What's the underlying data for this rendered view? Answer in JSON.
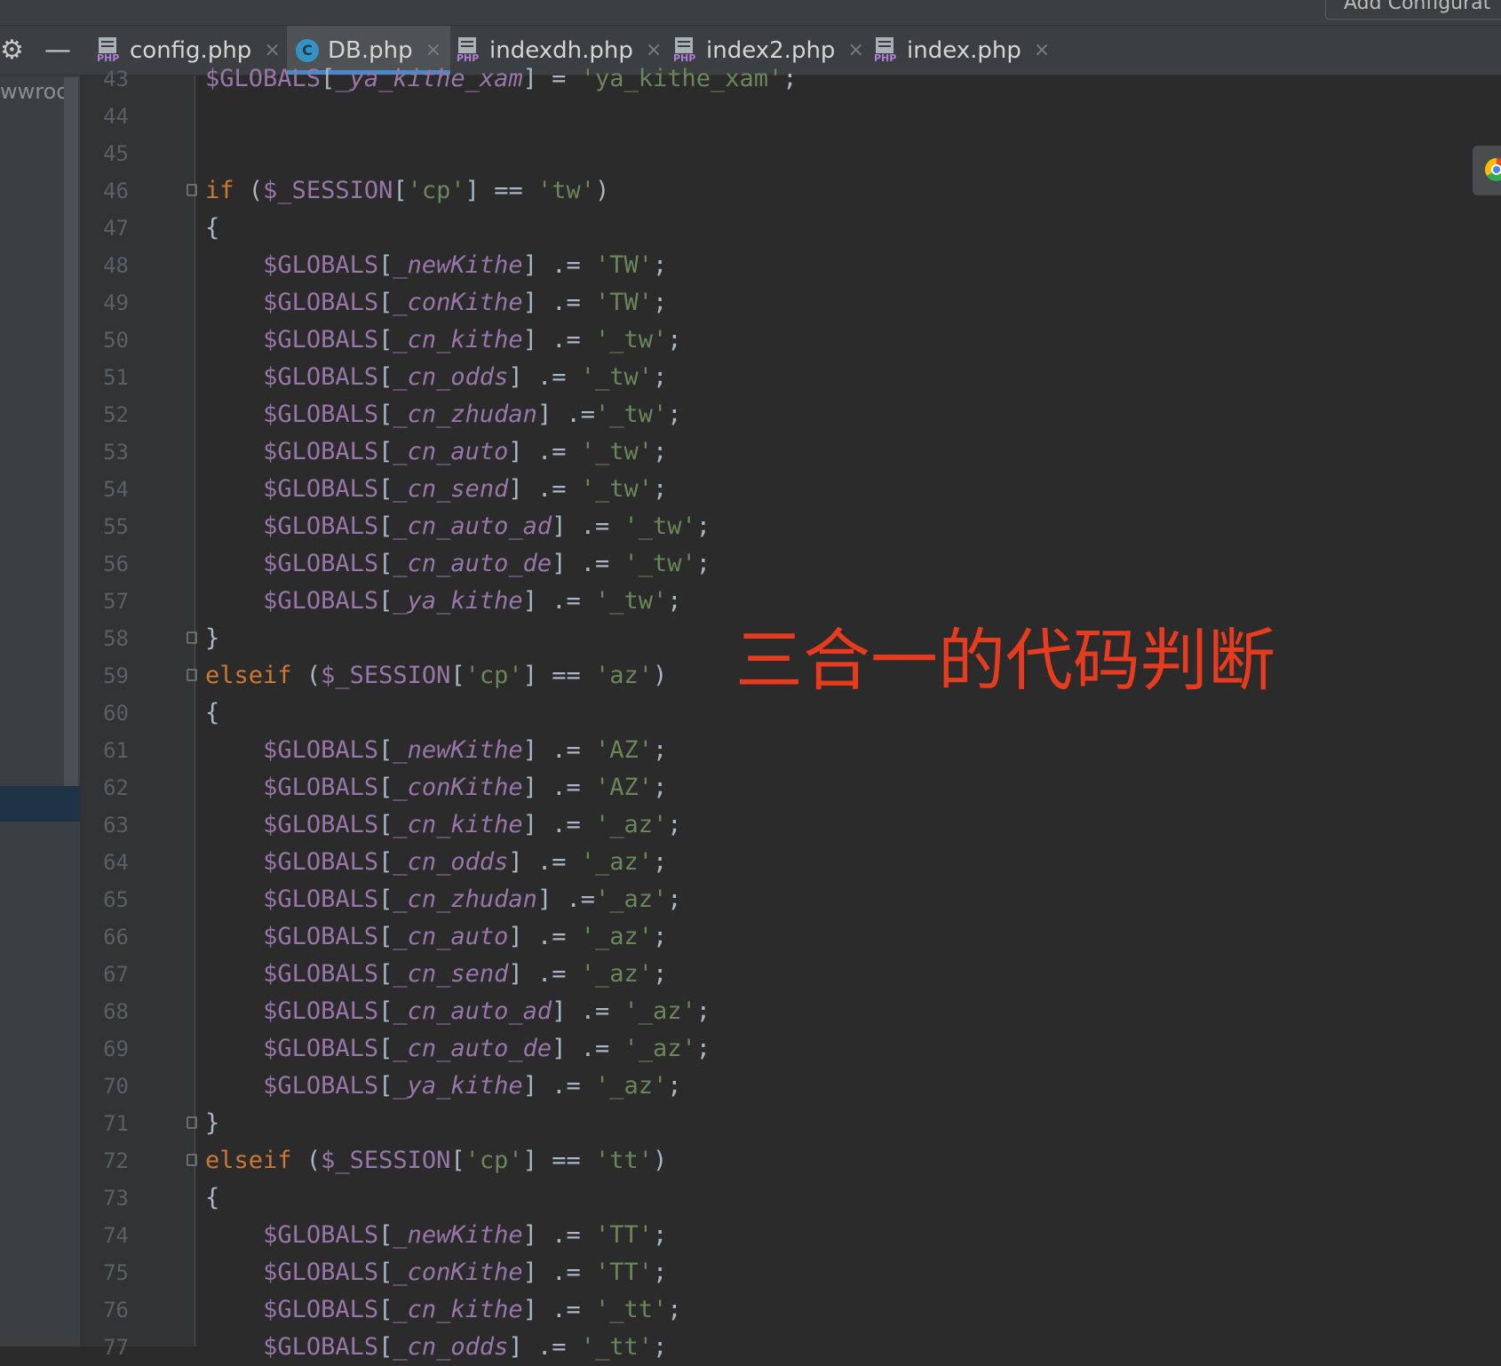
{
  "toolbar": {
    "add_configuration_label": "Add Configurat"
  },
  "tabs": [
    {
      "label": "config.php",
      "icon": "php-file-icon",
      "active": false
    },
    {
      "label": "DB.php",
      "icon": "php-class-icon",
      "active": true
    },
    {
      "label": "indexdh.php",
      "icon": "php-file-icon",
      "active": false
    },
    {
      "label": "index2.php",
      "icon": "php-file-icon",
      "active": false
    },
    {
      "label": "index.php",
      "icon": "php-file-icon",
      "active": false
    }
  ],
  "project_panel": {
    "label": "wwroot"
  },
  "annotation": "三合一的代码判断",
  "code_lines": [
    {
      "n": "43",
      "text": "$GLOBALS[_ya_kithe_xam] = 'ya_kithe_xam';"
    },
    {
      "n": "44",
      "text": ""
    },
    {
      "n": "45",
      "text": ""
    },
    {
      "n": "46",
      "text": "if ($_SESSION['cp'] == 'tw')"
    },
    {
      "n": "47",
      "text": "{"
    },
    {
      "n": "48",
      "text": "    $GLOBALS[_newKithe] .= 'TW';"
    },
    {
      "n": "49",
      "text": "    $GLOBALS[_conKithe] .= 'TW';"
    },
    {
      "n": "50",
      "text": "    $GLOBALS[_cn_kithe] .= '_tw';"
    },
    {
      "n": "51",
      "text": "    $GLOBALS[_cn_odds] .= '_tw';"
    },
    {
      "n": "52",
      "text": "    $GLOBALS[_cn_zhudan] .='_tw';"
    },
    {
      "n": "53",
      "text": "    $GLOBALS[_cn_auto] .= '_tw';"
    },
    {
      "n": "54",
      "text": "    $GLOBALS[_cn_send] .= '_tw';"
    },
    {
      "n": "55",
      "text": "    $GLOBALS[_cn_auto_ad] .= '_tw';"
    },
    {
      "n": "56",
      "text": "    $GLOBALS[_cn_auto_de] .= '_tw';"
    },
    {
      "n": "57",
      "text": "    $GLOBALS[_ya_kithe] .= '_tw';"
    },
    {
      "n": "58",
      "text": "}"
    },
    {
      "n": "59",
      "text": "elseif ($_SESSION['cp'] == 'az')"
    },
    {
      "n": "60",
      "text": "{"
    },
    {
      "n": "61",
      "text": "    $GLOBALS[_newKithe] .= 'AZ';"
    },
    {
      "n": "62",
      "text": "    $GLOBALS[_conKithe] .= 'AZ';"
    },
    {
      "n": "63",
      "text": "    $GLOBALS[_cn_kithe] .= '_az';"
    },
    {
      "n": "64",
      "text": "    $GLOBALS[_cn_odds] .= '_az';"
    },
    {
      "n": "65",
      "text": "    $GLOBALS[_cn_zhudan] .='_az';"
    },
    {
      "n": "66",
      "text": "    $GLOBALS[_cn_auto] .= '_az';"
    },
    {
      "n": "67",
      "text": "    $GLOBALS[_cn_send] .= '_az';"
    },
    {
      "n": "68",
      "text": "    $GLOBALS[_cn_auto_ad] .= '_az';"
    },
    {
      "n": "69",
      "text": "    $GLOBALS[_cn_auto_de] .= '_az';"
    },
    {
      "n": "70",
      "text": "    $GLOBALS[_ya_kithe] .= '_az';"
    },
    {
      "n": "71",
      "text": "}"
    },
    {
      "n": "72",
      "text": "elseif ($_SESSION['cp'] == 'tt')"
    },
    {
      "n": "73",
      "text": "{"
    },
    {
      "n": "74",
      "text": "    $GLOBALS[_newKithe] .= 'TT';"
    },
    {
      "n": "75",
      "text": "    $GLOBALS[_conKithe] .= 'TT';"
    },
    {
      "n": "76",
      "text": "    $GLOBALS[_cn_kithe] .= '_tt';"
    },
    {
      "n": "77",
      "text": "    $GLOBALS[_cn_odds] .= '_tt';"
    }
  ],
  "colors": {
    "keyword": "#cc7832",
    "variable": "#9876aa",
    "string": "#6a8759",
    "annotation": "#e63b1f"
  }
}
